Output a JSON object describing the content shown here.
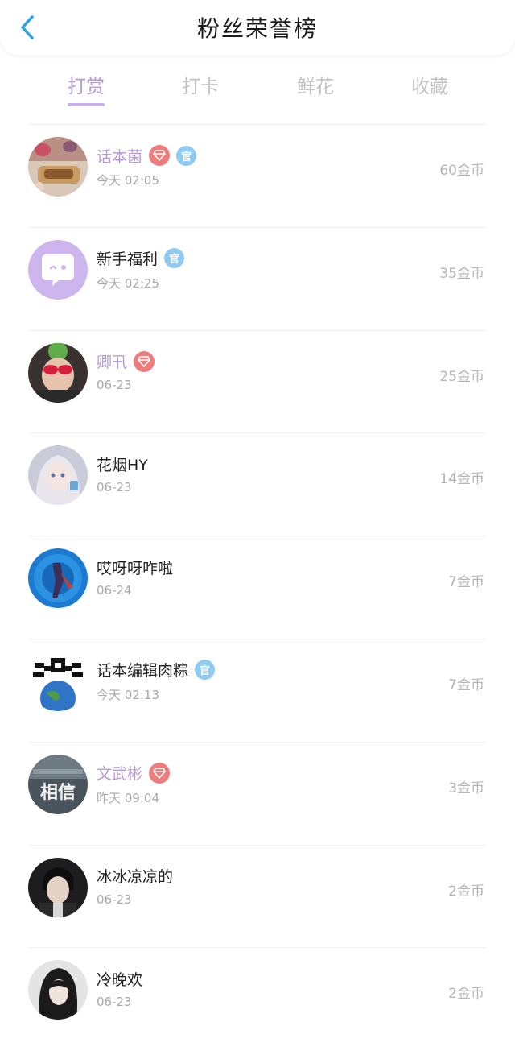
{
  "header": {
    "title": "粉丝荣誉榜",
    "back_icon": "chevron-left-icon"
  },
  "tabs": [
    {
      "label": "打赏",
      "active": true
    },
    {
      "label": "打卡",
      "active": false
    },
    {
      "label": "鲜花",
      "active": false
    },
    {
      "label": "收藏",
      "active": false
    }
  ],
  "colors": {
    "accent": "#b59ad9",
    "vip_badge": "#ef7c7c",
    "official_badge": "#8fcaf1",
    "back_icon": "#2aa3e6"
  },
  "badges": {
    "official_label": "官"
  },
  "rows": [
    {
      "name": "话本菌",
      "time": "今天 02:05",
      "amount": "60金币",
      "vip": true,
      "official": true,
      "avatar": "food-photo-avatar"
    },
    {
      "name": "新手福利",
      "time": "今天 02:25",
      "amount": "35金币",
      "vip": false,
      "official": true,
      "avatar": "chat-bubble-avatar"
    },
    {
      "name": "卿卂",
      "time": "06-23",
      "amount": "25金币",
      "vip": true,
      "official": false,
      "avatar": "portrait-red-glasses-avatar"
    },
    {
      "name": "花烟HY",
      "time": "06-23",
      "amount": "14金币",
      "vip": false,
      "official": false,
      "avatar": "anime-girl-avatar"
    },
    {
      "name": "哎呀呀咋啦",
      "time": "06-24",
      "amount": "7金币",
      "vip": false,
      "official": false,
      "avatar": "blue-figure-avatar"
    },
    {
      "name": "话本编辑肉粽",
      "time": "今天 02:13",
      "amount": "7金币",
      "vip": false,
      "official": true,
      "avatar": "pixel-earth-avatar"
    },
    {
      "name": "文武彬",
      "time": "昨天 09:04",
      "amount": "3金币",
      "vip": true,
      "official": false,
      "avatar": "text-photo-avatar",
      "avatar_text": "相信"
    },
    {
      "name": "冰冰凉凉的",
      "time": "06-23",
      "amount": "2金币",
      "vip": false,
      "official": false,
      "avatar": "dark-portrait-avatar"
    },
    {
      "name": "冷晚欢",
      "time": "06-23",
      "amount": "2金币",
      "vip": false,
      "official": false,
      "avatar": "long-hair-portrait-avatar"
    }
  ]
}
